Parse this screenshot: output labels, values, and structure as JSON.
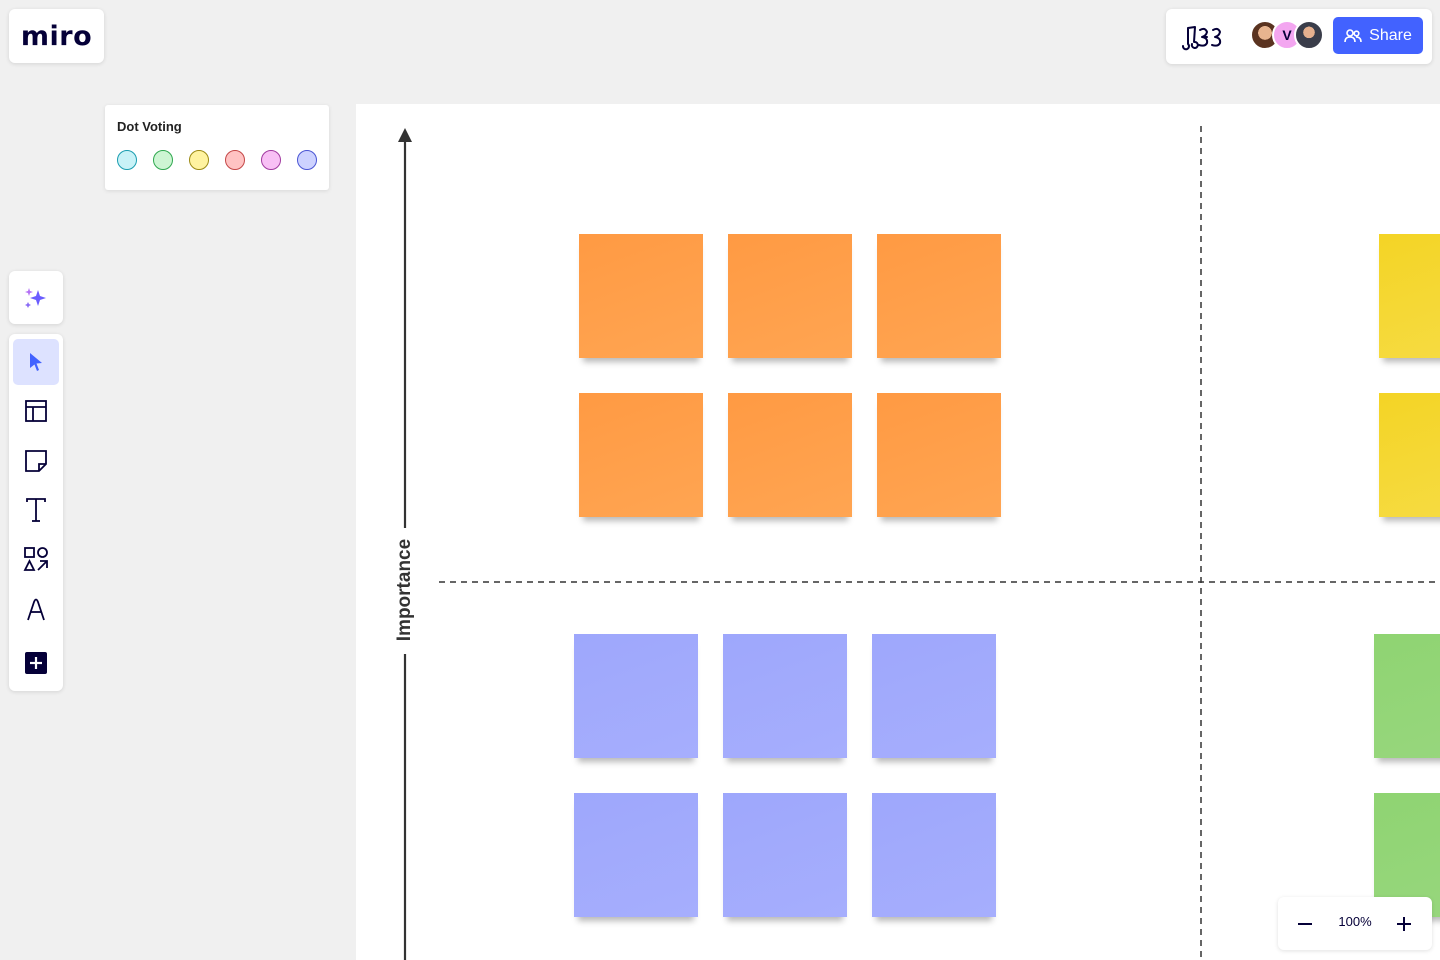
{
  "app": {
    "logo": "miro"
  },
  "collab": {
    "reactions_icon": "music-notes-reactions-icon",
    "avatars": [
      {
        "name": "collaborator-1",
        "initial": ""
      },
      {
        "name": "collaborator-2",
        "initial": "V",
        "color": "#f3a6f0"
      },
      {
        "name": "collaborator-3",
        "initial": ""
      }
    ],
    "share_label": "Share",
    "share_color": "#4262ff"
  },
  "dot_voting": {
    "title": "Dot Voting",
    "dots": [
      {
        "fill": "#c8f2f7",
        "stroke": "#1a9db0"
      },
      {
        "fill": "#cdf5d3",
        "stroke": "#2fa84f"
      },
      {
        "fill": "#fff3a0",
        "stroke": "#9c8a13"
      },
      {
        "fill": "#ffc3c3",
        "stroke": "#c44747"
      },
      {
        "fill": "#f8c0f5",
        "stroke": "#a13aa0"
      },
      {
        "fill": "#cdd2ff",
        "stroke": "#4a55d4"
      }
    ]
  },
  "toolbar": {
    "ai_icon": "sparkle-ai-icon",
    "tools": [
      "select",
      "templates",
      "sticky-note",
      "text",
      "shapes",
      "pen",
      "more-apps"
    ],
    "active": "select"
  },
  "board": {
    "y_axis_label": "Importance",
    "sticky_colors": {
      "orange": "#ff9a43",
      "yellow": "#f4d425",
      "purple": "#9ea7fc",
      "green": "#8fd472"
    }
  },
  "zoom": {
    "value": "100%"
  }
}
